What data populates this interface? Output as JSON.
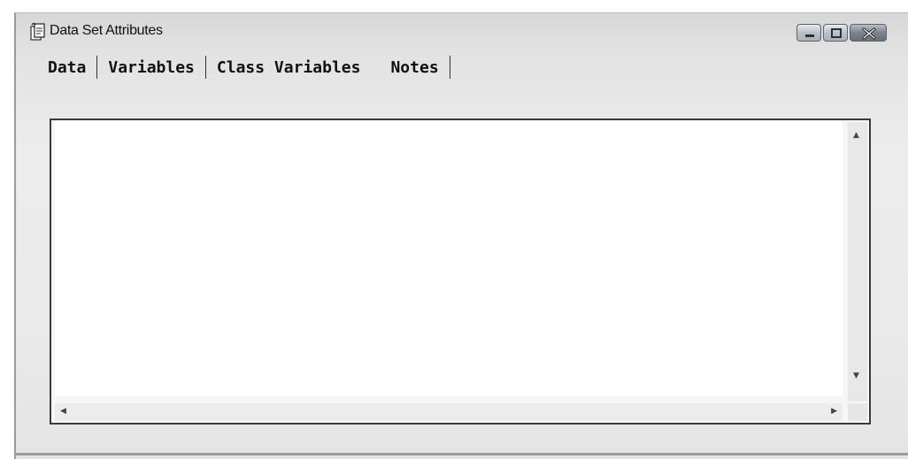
{
  "window": {
    "title": "Data Set Attributes",
    "controls": {
      "minimize": "minimize",
      "maximize": "maximize",
      "close": "close"
    }
  },
  "tabs": [
    {
      "label": "Data"
    },
    {
      "label": "Variables"
    },
    {
      "label": "Class Variables"
    },
    {
      "label": "Notes",
      "selected": true
    }
  ],
  "notes_text": "",
  "icons": {
    "app": "document-properties-icon",
    "scroll_up": "arrow-up-icon",
    "scroll_down": "arrow-down-icon",
    "scroll_left": "arrow-left-icon",
    "scroll_right": "arrow-right-icon"
  },
  "colors": {
    "window_bg": "#e8e8e8",
    "text_area_bg": "#ffffff",
    "close_button": "#7c838b"
  }
}
